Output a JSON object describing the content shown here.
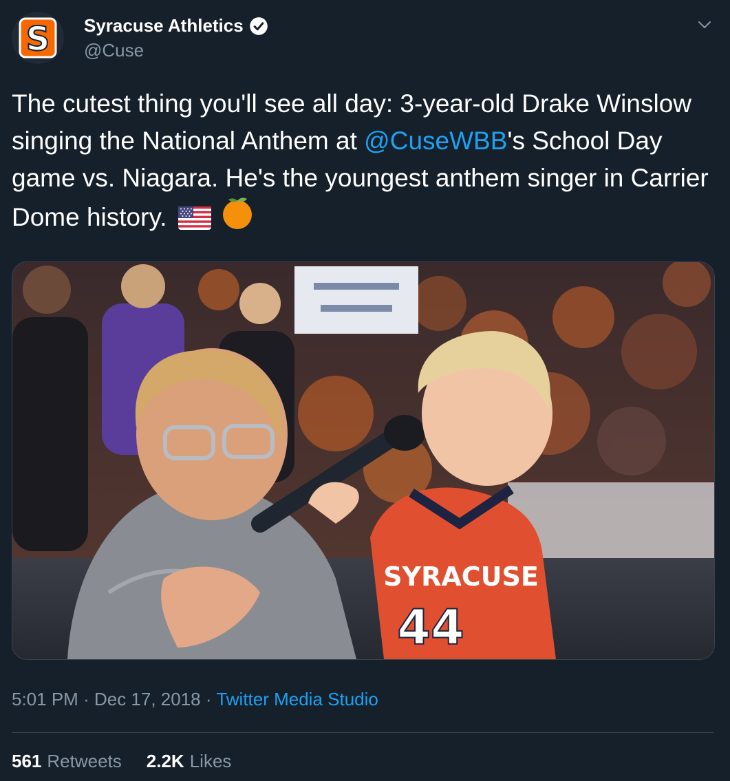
{
  "author": {
    "name": "Syracuse Athletics",
    "handle": "@Cuse",
    "verified": true,
    "avatar_letter": "S"
  },
  "tweet": {
    "text_before": "The cutest thing you'll see all day: 3-year-old Drake Winslow singing the National Anthem at ",
    "mention": "@CuseWBB",
    "text_after": "'s School Day game vs. Niagara. He's the youngest anthem singer in Carrier Dome history.",
    "emojis": [
      "us-flag-emoji",
      "orange-emoji"
    ]
  },
  "media": {
    "jersey_text": "SYRACUSE",
    "jersey_number": "44"
  },
  "meta": {
    "time": "5:01 PM",
    "separator": "·",
    "date": "Dec 17, 2018",
    "source": "Twitter Media Studio"
  },
  "stats": {
    "retweets_count": "561",
    "retweets_label": "Retweets",
    "likes_count": "2.2K",
    "likes_label": "Likes"
  },
  "colors": {
    "background": "#15202b",
    "accent": "#1da1f2",
    "secondary_text": "#8899a6",
    "syracuse_orange": "#f76900"
  }
}
